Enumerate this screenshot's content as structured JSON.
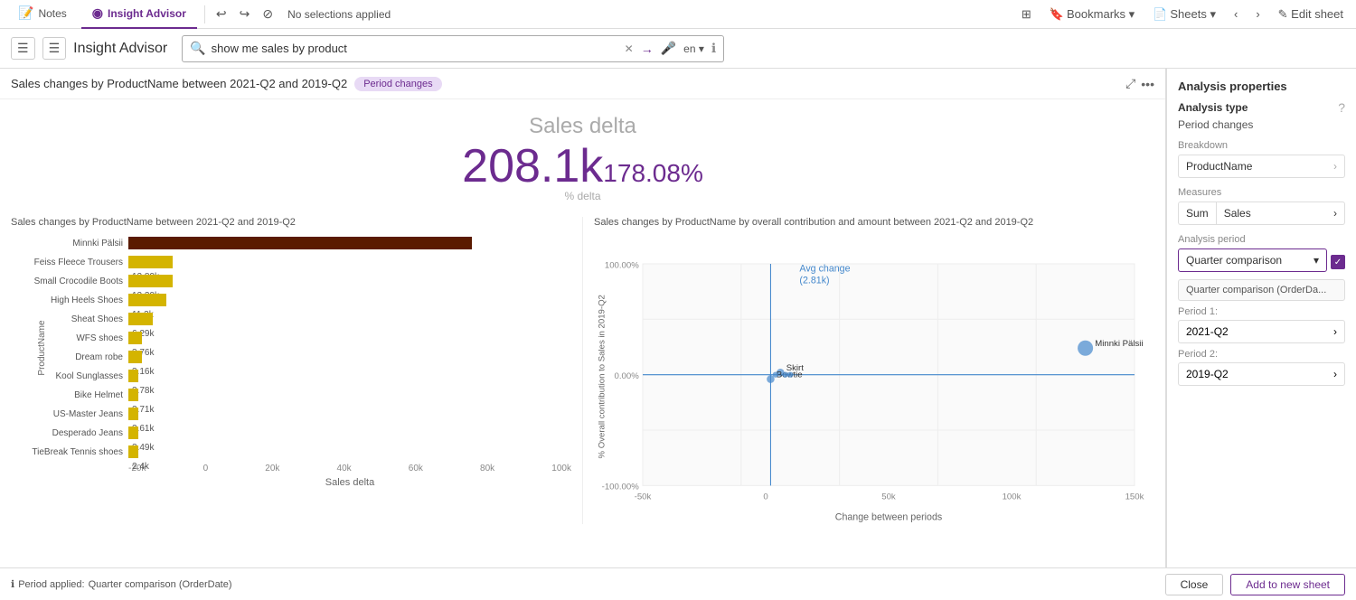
{
  "topNav": {
    "tabs": [
      {
        "id": "notes",
        "label": "Notes",
        "icon": "📝",
        "active": false
      },
      {
        "id": "insight",
        "label": "Insight Advisor",
        "icon": "◉",
        "active": true
      }
    ],
    "navButtons": [
      "↩",
      "↪",
      "⊘"
    ],
    "selectionStatus": "No selections applied",
    "rightButtons": [
      {
        "id": "grid",
        "label": "⊞"
      },
      {
        "id": "bookmarks",
        "label": "Bookmarks ▾"
      },
      {
        "id": "sheets",
        "label": "Sheets ▾"
      },
      {
        "id": "nav-prev",
        "label": "‹"
      },
      {
        "id": "nav-next",
        "label": "›"
      },
      {
        "id": "edit",
        "label": "✎ Edit sheet"
      }
    ]
  },
  "toolbar": {
    "title": "Insight Advisor",
    "searchText": "show me sales by product",
    "searchKeyword": "sales",
    "languageLabel": "en ▾",
    "panelToggleIcon": "☰"
  },
  "chartHeader": {
    "title": "Sales changes by ProductName between 2021-Q2 and 2019-Q2",
    "badge": "Period changes"
  },
  "delta": {
    "label": "Sales delta",
    "value": "208.1k",
    "percent": "178.08%",
    "sub": "% delta"
  },
  "barChart": {
    "title": "Sales changes by ProductName between 2021-Q2 and 2019-Q2",
    "xAxisLabel": "Sales delta",
    "yAxisLabel": "ProductName",
    "xTicks": [
      "-20k",
      "0",
      "20k",
      "40k",
      "60k",
      "80k",
      "100k"
    ],
    "bars": [
      {
        "label": "Minnki Pälsii",
        "value": 100,
        "displayValue": "",
        "color": "#5a1a00"
      },
      {
        "label": "Feiss Fleece Trousers",
        "value": 13,
        "displayValue": "12.89k",
        "color": "#d4b400"
      },
      {
        "label": "Small Crocodile Boots",
        "value": 13,
        "displayValue": "12.39k",
        "color": "#d4b400"
      },
      {
        "label": "High Heels Shoes",
        "value": 11,
        "displayValue": "11.3k",
        "color": "#d4b400"
      },
      {
        "label": "Sheat Shoes",
        "value": 7,
        "displayValue": "6.29k",
        "color": "#d4b400"
      },
      {
        "label": "WFS shoes",
        "value": 4,
        "displayValue": "3.76k",
        "color": "#d4b400"
      },
      {
        "label": "Dream robe",
        "value": 4,
        "displayValue": "3.16k",
        "color": "#d4b400"
      },
      {
        "label": "Kool Sunglasses",
        "value": 3,
        "displayValue": "2.78k",
        "color": "#d4b400"
      },
      {
        "label": "Bike Helmet",
        "value": 3,
        "displayValue": "2.71k",
        "color": "#d4b400"
      },
      {
        "label": "US-Master Jeans",
        "value": 3,
        "displayValue": "2.61k",
        "color": "#d4b400"
      },
      {
        "label": "Desperado Jeans",
        "value": 3,
        "displayValue": "2.49k",
        "color": "#d4b400"
      },
      {
        "label": "TieBreak Tennis shoes",
        "value": 3,
        "displayValue": "2.4k",
        "color": "#d4b400"
      }
    ]
  },
  "scatterChart": {
    "title": "Sales changes by ProductName by overall contribution and amount between 2021-Q2 and 2019-Q2",
    "xAxisLabel": "Change between periods",
    "yAxisLabel": "% Overall contribution to Sales in 2019-Q2",
    "avgChangeLabel": "Avg change",
    "avgChangeSub": "(2.81k)",
    "yTicks": [
      "100.00%",
      "0.00%",
      "-100.00%"
    ],
    "xTicks": [
      "-50k",
      "0",
      "50k",
      "100k",
      "150k"
    ],
    "points": [
      {
        "label": "Minnki Pälsii",
        "x": 82,
        "y": 42,
        "r": 12
      },
      {
        "label": "Skirt",
        "x": 40,
        "y": 50,
        "r": 5
      },
      {
        "label": "Bowtie",
        "x": 40,
        "y": 53,
        "r": 5
      }
    ]
  },
  "rightPanel": {
    "title": "Analysis properties",
    "analysisTypeLabel": "Analysis type",
    "analysisTypeValue": "Period changes",
    "helpIcon": "?",
    "breakdownLabel": "Breakdown",
    "breakdownValue": "ProductName",
    "measuresLabel": "Measures",
    "measuresPart1": "Sum",
    "measuresPart2": "Sales",
    "analysisPeriodLabel": "Analysis period",
    "periodSelectValue": "Quarter comparison",
    "periodSelectOption": "Quarter comparison (OrderDa...",
    "period1Label": "Period 1:",
    "period1Value": "2021-Q2",
    "period2Label": "Period 2:",
    "period2Value": "2019-Q2"
  },
  "bottomBar": {
    "infoIcon": "ℹ",
    "periodAppliedText": "Period applied:",
    "periodAppliedValue": "Quarter comparison (OrderDate)",
    "closeButton": "Close",
    "addButton": "Add to new sheet"
  }
}
